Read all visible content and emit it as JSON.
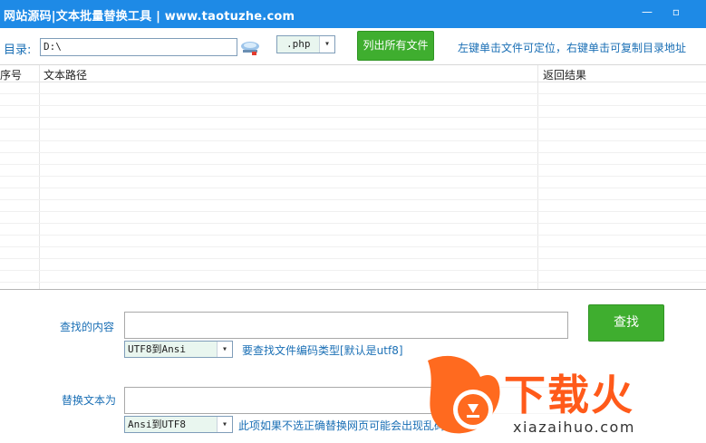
{
  "window": {
    "title": "网站源码|文本批量替换工具 | www.taotuzhe.com",
    "minimize_glyph": "—",
    "maximize_glyph": "▫"
  },
  "toolbar": {
    "dir_label": "目录:",
    "dir_value": "D:\\",
    "folder_icon": "folder-browse-icon",
    "ext_value": ".php",
    "list_button": "列出所有文件",
    "hint": "左键单击文件可定位，右键单击可复制目录地址"
  },
  "table": {
    "columns": [
      "序号",
      "文本路径",
      "返回结果"
    ],
    "rows": []
  },
  "search": {
    "label": "查找的内容",
    "value": "",
    "encoding": "UTF8到Ansi",
    "encoding_note": "要查找文件编码类型[默认是utf8]",
    "button": "查找"
  },
  "replace": {
    "label": "替换文本为",
    "value": "",
    "encoding": "Ansi到UTF8",
    "encoding_note": "此项如果不选正确替换网页可能会出现乱码"
  },
  "watermark": {
    "brand": "下载火",
    "url": "xiazaihuo.com",
    "brand_color": "#ff5a1a"
  },
  "colors": {
    "titlebar": "#1e8ae6",
    "accent_text": "#1a6fb5",
    "button_green": "#3fae2f"
  }
}
